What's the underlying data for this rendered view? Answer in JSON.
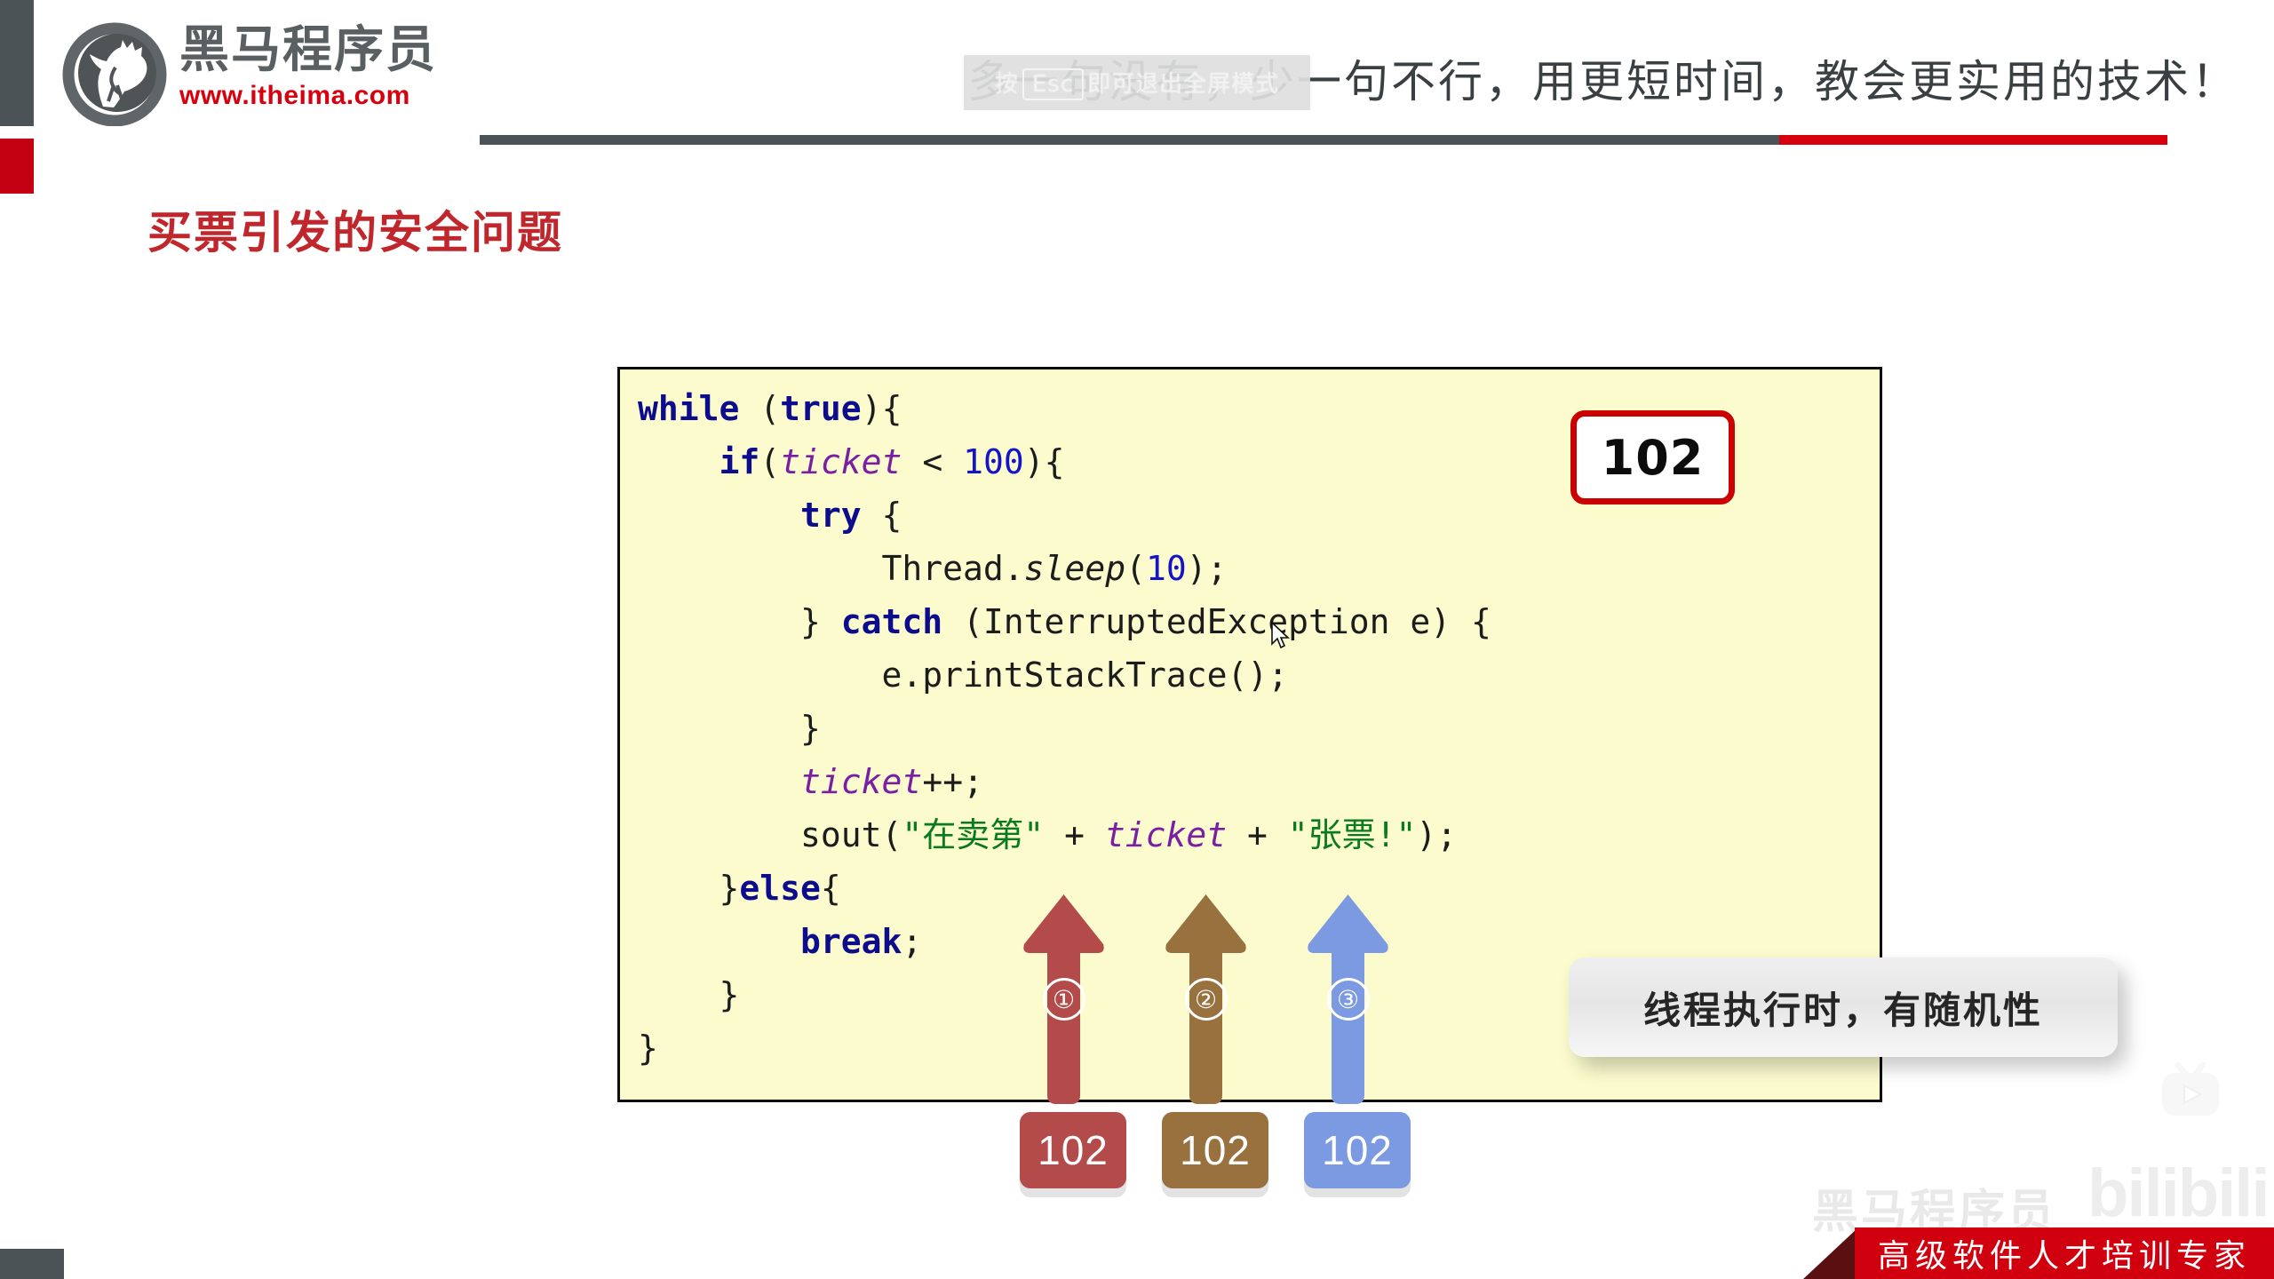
{
  "brand": {
    "name_cn": "黑马程序员",
    "url": "www.itheima.com",
    "logo_icon": "horse-head-circle-icon"
  },
  "header": {
    "tagline": "多一句没有，少一句不行，用更短时间，教会更实用的技术！",
    "fullscreen_toast": {
      "prefix": "按",
      "key": "Esc",
      "suffix": "即可退出全屏模式"
    }
  },
  "slide": {
    "title": "买票引发的安全问题",
    "code_lines": [
      [
        {
          "t": "while ",
          "c": "kw"
        },
        {
          "t": "(",
          "c": "pl"
        },
        {
          "t": "true",
          "c": "kw"
        },
        {
          "t": "){",
          "c": "pl"
        }
      ],
      [
        {
          "t": "    ",
          "c": "pl"
        },
        {
          "t": "if",
          "c": "kw"
        },
        {
          "t": "(",
          "c": "pl"
        },
        {
          "t": "ticket",
          "c": "var"
        },
        {
          "t": " < ",
          "c": "pl"
        },
        {
          "t": "100",
          "c": "num"
        },
        {
          "t": "){",
          "c": "pl"
        }
      ],
      [
        {
          "t": "        ",
          "c": "pl"
        },
        {
          "t": "try",
          "c": "kw"
        },
        {
          "t": " {",
          "c": "pl"
        }
      ],
      [
        {
          "t": "            Thread.",
          "c": "pl"
        },
        {
          "t": "sleep",
          "c": "mth"
        },
        {
          "t": "(",
          "c": "pl"
        },
        {
          "t": "10",
          "c": "num"
        },
        {
          "t": ");",
          "c": "pl"
        }
      ],
      [
        {
          "t": "        } ",
          "c": "pl"
        },
        {
          "t": "catch",
          "c": "kw"
        },
        {
          "t": " (InterruptedException e) {",
          "c": "pl"
        }
      ],
      [
        {
          "t": "            e.printStackTrace();",
          "c": "pl"
        }
      ],
      [
        {
          "t": "        }",
          "c": "pl"
        }
      ],
      [
        {
          "t": "        ",
          "c": "pl"
        },
        {
          "t": "ticket",
          "c": "var"
        },
        {
          "t": "++;",
          "c": "pl"
        }
      ],
      [
        {
          "t": "        sout(",
          "c": "pl"
        },
        {
          "t": "\"在卖第\"",
          "c": "str"
        },
        {
          "t": " + ",
          "c": "pl"
        },
        {
          "t": "ticket",
          "c": "var"
        },
        {
          "t": " + ",
          "c": "pl"
        },
        {
          "t": "\"张票!\"",
          "c": "str"
        },
        {
          "t": ");",
          "c": "pl"
        }
      ],
      [
        {
          "t": "    }",
          "c": "pl"
        },
        {
          "t": "else",
          "c": "kw"
        },
        {
          "t": "{",
          "c": "pl"
        }
      ],
      [
        {
          "t": "        ",
          "c": "pl"
        },
        {
          "t": "break",
          "c": "kw"
        },
        {
          "t": ";",
          "c": "pl"
        }
      ],
      [
        {
          "t": "    }",
          "c": "pl"
        }
      ],
      [
        {
          "t": "}",
          "c": "pl"
        }
      ]
    ],
    "ticket_badge": "102",
    "arrows": [
      {
        "label": "①",
        "value": "102",
        "color": "#b34b4b"
      },
      {
        "label": "②",
        "value": "102",
        "color": "#99713f"
      },
      {
        "label": "③",
        "value": "102",
        "color": "#7c9ae2"
      }
    ],
    "callout": "线程执行时，有随机性"
  },
  "watermarks": {
    "heima": "黑马程序员",
    "bilibili": "bilibili",
    "tv_icon": "bilibili-tv-play-icon"
  },
  "footer": {
    "slogan": "高级软件人才培训专家"
  },
  "colors": {
    "brand_red": "#c20012",
    "brand_gray": "#4c5356",
    "title_red": "#c0272d",
    "code_bg": "#fbfbce",
    "keyword": "#0c0c8c",
    "variable": "#7a1fa2",
    "number": "#1414c8",
    "string": "#0a7a1f"
  }
}
